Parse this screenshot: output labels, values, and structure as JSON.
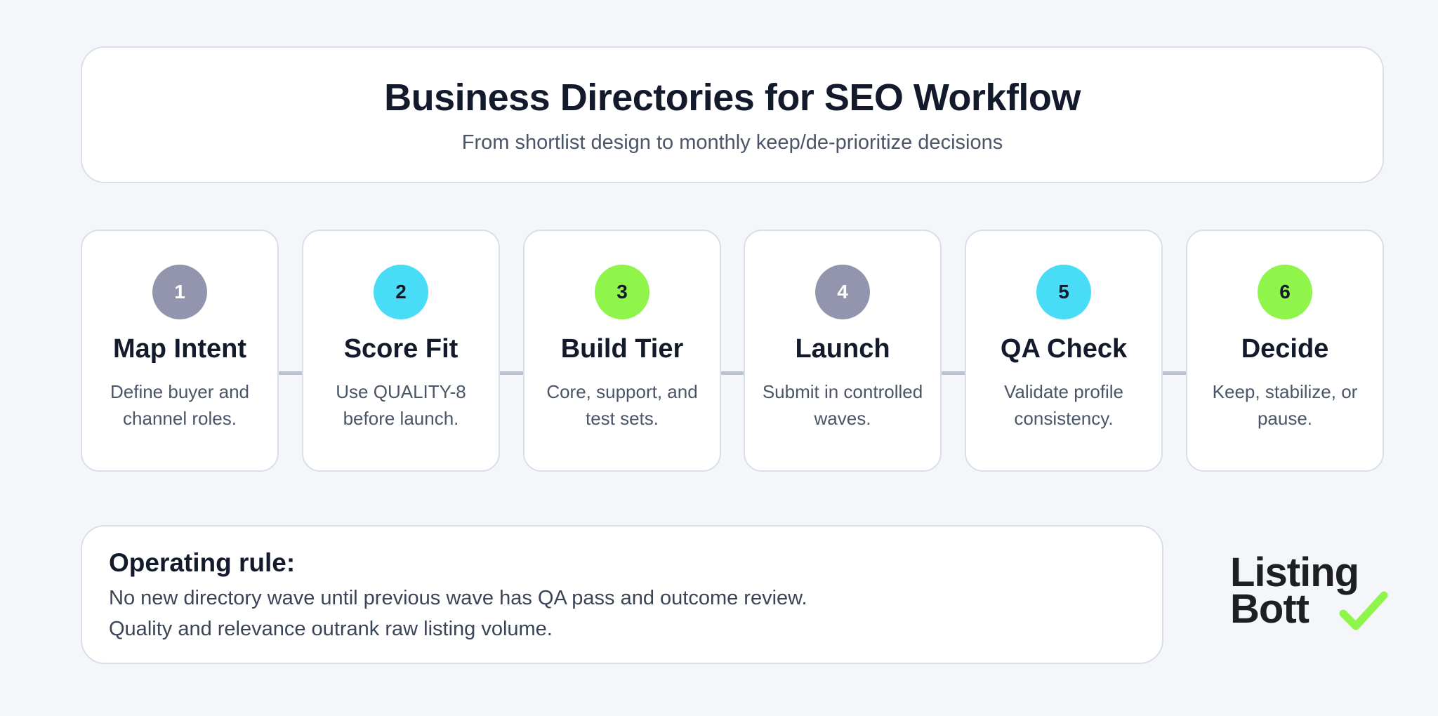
{
  "header": {
    "title": "Business Directories for SEO Workflow",
    "subtitle": "From shortlist design to monthly keep/de-prioritize decisions"
  },
  "steps": [
    {
      "number": "1",
      "title": "Map Intent",
      "description": "Define buyer and channel roles.",
      "color": "#9394ad"
    },
    {
      "number": "2",
      "title": "Score Fit",
      "description": "Use QUALITY-8 before launch.",
      "color": "#49dcf7"
    },
    {
      "number": "3",
      "title": "Build Tier",
      "description": "Core, support, and test sets.",
      "color": "#8ff54a"
    },
    {
      "number": "4",
      "title": "Launch",
      "description": "Submit in controlled waves.",
      "color": "#9394ad"
    },
    {
      "number": "5",
      "title": "QA Check",
      "description": "Validate profile consistency.",
      "color": "#49dcf7"
    },
    {
      "number": "6",
      "title": "Decide",
      "description": "Keep, stabilize, or pause.",
      "color": "#8ff54a"
    }
  ],
  "rule": {
    "heading": "Operating rule:",
    "lines": [
      "No new directory wave until previous wave has QA pass and outcome review.",
      "Quality and relevance outrank raw listing volume."
    ]
  },
  "logo": {
    "line1": "Listing",
    "line2": "Bott",
    "icon": "checkmark-icon",
    "accent": "#8ff54a"
  }
}
